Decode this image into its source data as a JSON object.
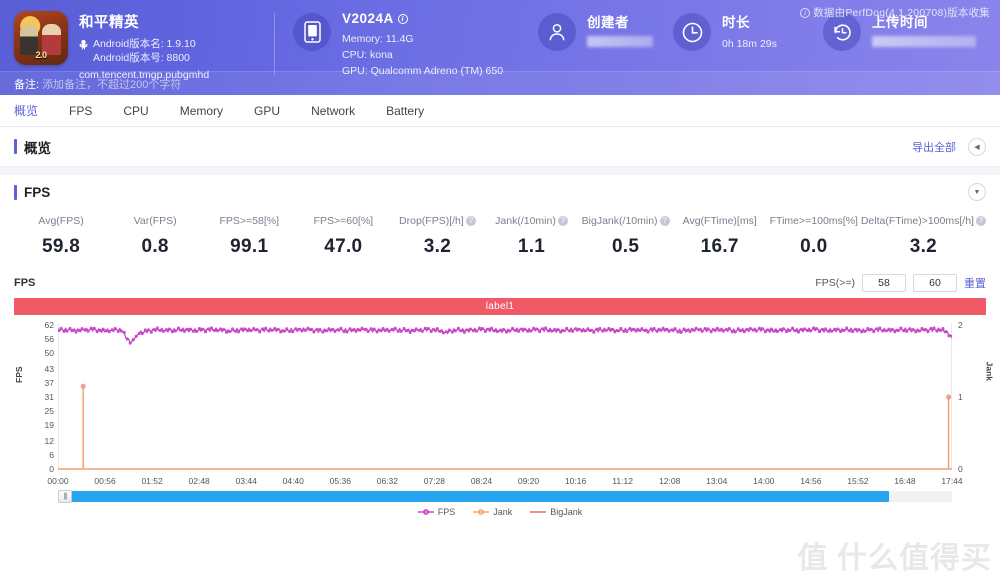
{
  "header": {
    "perfdog_note": "数据由PerfDog(4.1.200708)版本收集",
    "app": {
      "name": "和平精英",
      "icon_label": "2.0",
      "version_name": "Android版本名: 1.9.10",
      "version_code": "Android版本号: 8800",
      "package": "com.tencent.tmgp.pubgmhd"
    },
    "device": {
      "model": "V2024A",
      "memory": "Memory: 11.4G",
      "cpu": "CPU: kona",
      "gpu": "GPU: Qualcomm Adreno (TM) 650"
    },
    "creator": {
      "label": "创建者",
      "value": ""
    },
    "duration": {
      "label": "时长",
      "value": "0h 18m 29s"
    },
    "upload": {
      "label": "上传时间",
      "value": ""
    },
    "note": {
      "key": "备注:",
      "placeholder": "添加备注，不超过200个字符"
    }
  },
  "tabs": [
    {
      "label": "概览",
      "active": true
    },
    {
      "label": "FPS",
      "active": false
    },
    {
      "label": "CPU",
      "active": false
    },
    {
      "label": "Memory",
      "active": false
    },
    {
      "label": "GPU",
      "active": false
    },
    {
      "label": "Network",
      "active": false
    },
    {
      "label": "Battery",
      "active": false
    }
  ],
  "overview": {
    "title": "概览",
    "export_all": "导出全部",
    "collapse_icon": "chevron-left-icon"
  },
  "fps_card": {
    "title": "FPS",
    "expand_icon": "chevron-down-icon",
    "chart_label": "FPS",
    "filter_label": "FPS(>=)",
    "filter_value_1": "58",
    "filter_value_2": "60",
    "reset_label": "重置",
    "band_label": "label1"
  },
  "metrics": [
    {
      "name": "Avg(FPS)",
      "value": "59.8",
      "help": false
    },
    {
      "name": "Var(FPS)",
      "value": "0.8",
      "help": false
    },
    {
      "name": "FPS>=58[%]",
      "value": "99.1",
      "help": false
    },
    {
      "name": "FPS>=60[%]",
      "value": "47.0",
      "help": false
    },
    {
      "name": "Drop(FPS)[/h]",
      "value": "3.2",
      "help": true
    },
    {
      "name": "Jank(/10min)",
      "value": "1.1",
      "help": true
    },
    {
      "name": "BigJank(/10min)",
      "value": "0.5",
      "help": true
    },
    {
      "name": "Avg(FTime)[ms]",
      "value": "16.7",
      "help": false
    },
    {
      "name": "FTime>=100ms[%]",
      "value": "0.0",
      "help": false
    },
    {
      "name": "Delta(FTime)>100ms[/h]",
      "value": "3.2",
      "help": true
    }
  ],
  "chart_data": {
    "type": "line",
    "title": "FPS",
    "xlabel": "",
    "ylabel": "FPS",
    "y2label": "Jank",
    "ylim": [
      0,
      62
    ],
    "y2lim": [
      0,
      2
    ],
    "grid": false,
    "legend_position": "bottom",
    "colors": {
      "fps": "#c540c5",
      "jank": "#f4a06a",
      "bigjank": "#ef5a66",
      "band": "#ef5a66"
    },
    "yticks": [
      0,
      6,
      12,
      19,
      25,
      31,
      37,
      43,
      50,
      56,
      62
    ],
    "y2ticks": [
      0,
      1,
      2
    ],
    "xticks": [
      "00:00",
      "00:56",
      "01:52",
      "02:48",
      "03:44",
      "04:40",
      "05:36",
      "06:32",
      "07:28",
      "08:24",
      "09:20",
      "10:16",
      "11:12",
      "12:08",
      "13:04",
      "14:00",
      "14:56",
      "15:52",
      "16:48",
      "17:44"
    ],
    "legend": [
      {
        "name": "FPS",
        "marker": "line-dot",
        "color": "#c540c5"
      },
      {
        "name": "Jank",
        "marker": "line-dot",
        "color": "#f4a06a"
      },
      {
        "name": "BigJank",
        "marker": "line",
        "color": "#ef5a66"
      }
    ],
    "series": [
      {
        "name": "FPS",
        "axis": "left",
        "color": "#c540c5",
        "note": "Near-constant around 59-60 fps with small jitter; one dip to ~54 near 00:30",
        "values": [
          59.8,
          60,
          59.6,
          59.9,
          60,
          59.5,
          59.8,
          60,
          54.2,
          58.6,
          59.4,
          60,
          59.7,
          59.9,
          60,
          59.6,
          59.8,
          60,
          59.9,
          59.5,
          59.8,
          60,
          59.7,
          59.9,
          60,
          59.6,
          59.8,
          60,
          59.9,
          59.4,
          59.8,
          60,
          59.7,
          59.9,
          60,
          59.6,
          59.8,
          60,
          59.9,
          59.5,
          59.8,
          60,
          59.7,
          58.9,
          60,
          59.6,
          59.8,
          60,
          59.9,
          59.5,
          59.8,
          60,
          59.7,
          59.9,
          60,
          59.6,
          59.8,
          60,
          59.9,
          59.5,
          59.8,
          60,
          59.7,
          59.9,
          60,
          59.6,
          59.8,
          60,
          59.9,
          59.5,
          59.8,
          60,
          59.7,
          59.9,
          60,
          59.6,
          59.8,
          60,
          59.9,
          59.5,
          59.8,
          60,
          59.7,
          59.9,
          60,
          59.6,
          59.8,
          60,
          59.9,
          59.5,
          59.8,
          60,
          59.7,
          59.9,
          60,
          59.6,
          59.8,
          60,
          59.9,
          57.1
        ]
      },
      {
        "name": "Jank",
        "axis": "right",
        "color": "#f4a06a",
        "note": "Flat at 0 except one spike to ~1.15 at 00:30 and one point of 1 at the end",
        "spikes": [
          {
            "x": "00:30",
            "y": 1.15
          },
          {
            "x": "17:40",
            "y": 1.0
          }
        ]
      },
      {
        "name": "BigJank",
        "axis": "right",
        "color": "#ef5a66",
        "note": "Flat at 0 over full range",
        "spikes": []
      }
    ]
  },
  "watermark": "值 什么值得买"
}
